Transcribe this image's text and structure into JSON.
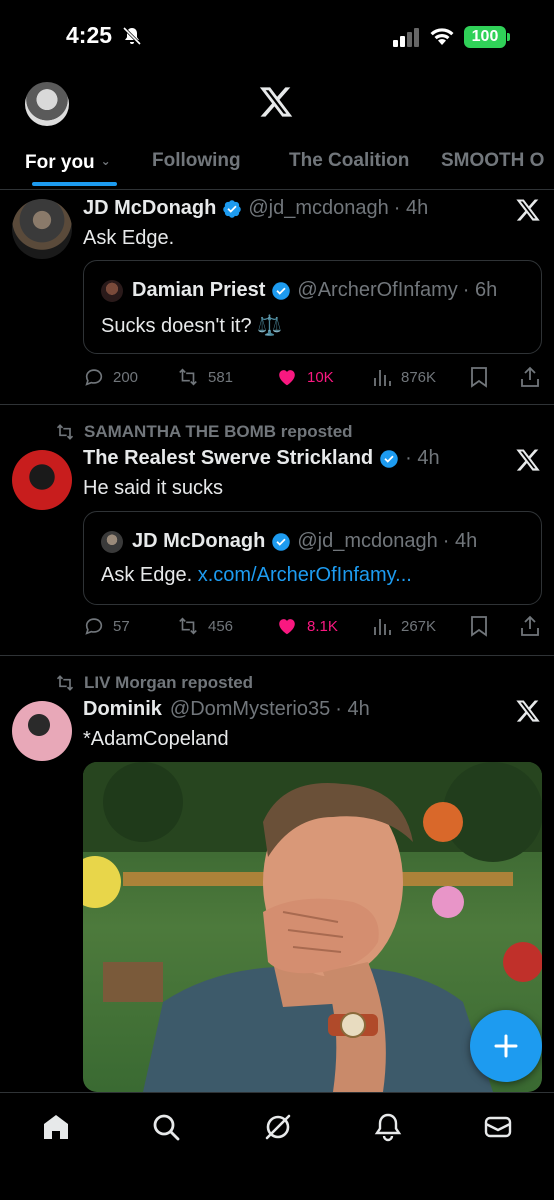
{
  "status": {
    "time": "4:25",
    "battery": "100"
  },
  "tabs": [
    {
      "label": "For you",
      "active": true
    },
    {
      "label": "Following",
      "active": false
    },
    {
      "label": "The Coalition",
      "active": false
    },
    {
      "label": "SMOOTH O",
      "active": false
    }
  ],
  "tweets": [
    {
      "name": "JD McDonagh",
      "handle": "@jd_mcdonagh",
      "time": "· 4h",
      "text": "Ask Edge.",
      "quote": {
        "name": "Damian Priest",
        "handle": "@ArcherOfInfamy",
        "time": "· 6h",
        "text": "Sucks doesn't it? ⚖️",
        "link": ""
      },
      "stats": {
        "replies": "200",
        "reposts": "581",
        "likes": "10K",
        "views": "876K"
      }
    },
    {
      "repost_by": "SAMANTHA THE BOMB reposted",
      "name": "The Realest Swerve Strickland",
      "handle": "",
      "time": "· 4h",
      "text": "He said it sucks",
      "quote": {
        "name": "JD McDonagh",
        "handle": "@jd_mcdonagh",
        "time": "· 4h",
        "text": "Ask Edge. ",
        "link": "x.com/ArcherOfInfamy..."
      },
      "stats": {
        "replies": "57",
        "reposts": "456",
        "likes": "8.1K",
        "views": "267K"
      }
    },
    {
      "repost_by": "LIV Morgan reposted",
      "name": "Dominik",
      "handle": "@DomMysterio35",
      "time": "· 4h",
      "text": "*AdamCopeland"
    }
  ],
  "colors": {
    "accent": "#1d9bf0",
    "like": "#f91880",
    "muted": "#71767b",
    "battery": "#30d158"
  },
  "nav": [
    "home-icon",
    "search-icon",
    "grok-icon",
    "notifications-icon",
    "messages-icon"
  ]
}
